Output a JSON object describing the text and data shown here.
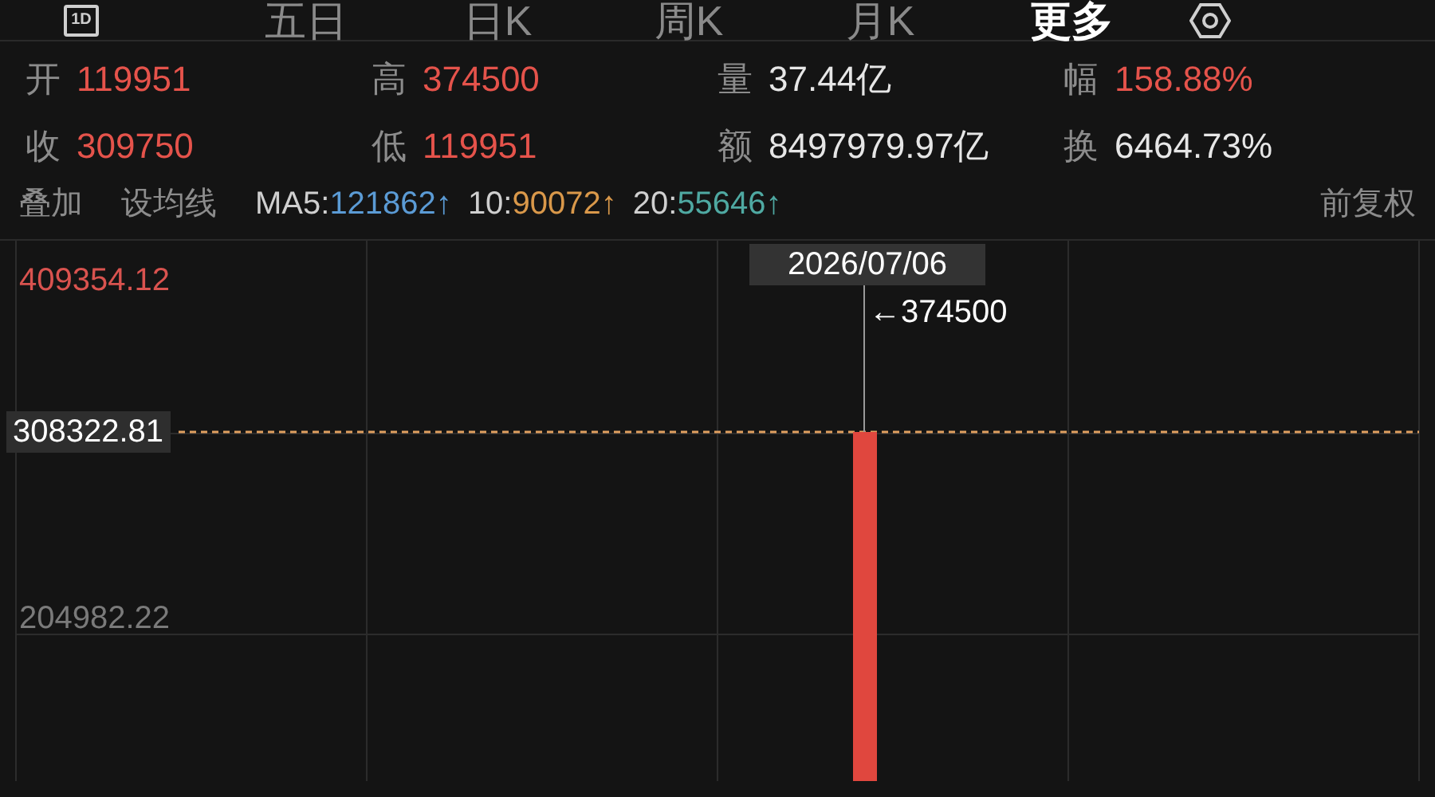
{
  "period_icon": {
    "label": "1D"
  },
  "tabs": [
    {
      "label": "五日",
      "selected": false
    },
    {
      "label": "日K",
      "selected": false
    },
    {
      "label": "周K",
      "selected": false
    },
    {
      "label": "月K",
      "selected": false
    },
    {
      "label": "更多",
      "selected": true
    }
  ],
  "stats": [
    {
      "label": "开",
      "value": "119951",
      "color": "#e5534b"
    },
    {
      "label": "高",
      "value": "374500",
      "color": "#e5534b"
    },
    {
      "label": "量",
      "value": "37.44亿",
      "color": "#e6e6e6"
    },
    {
      "label": "幅",
      "value": "158.88%",
      "color": "#e5534b"
    },
    {
      "label": "收",
      "value": "309750",
      "color": "#e5534b"
    },
    {
      "label": "低",
      "value": "119951",
      "color": "#e5534b"
    },
    {
      "label": "额",
      "value": "8497979.97亿",
      "color": "#e6e6e6"
    },
    {
      "label": "换",
      "value": "6464.73%",
      "color": "#e6e6e6"
    }
  ],
  "toolbar": {
    "buttons": [
      "叠加",
      "设均线"
    ],
    "moving_averages": [
      {
        "label": "MA5:",
        "value": "121862↑",
        "color": "#5b9bd5"
      },
      {
        "label": "10:",
        "value": "90072↑",
        "color": "#d9984a"
      },
      {
        "label": "20:",
        "value": "55646↑",
        "color": "#4fa9a2"
      }
    ],
    "adjustment": "前复权"
  },
  "chart": {
    "price_labels": [
      {
        "kind": "high",
        "text": "409354.12"
      },
      {
        "kind": "current",
        "text": "308322.81"
      },
      {
        "kind": "mid",
        "text": "204982.22"
      }
    ],
    "crosshair": {
      "date": "2026/07/06",
      "value": "←374500"
    }
  }
}
